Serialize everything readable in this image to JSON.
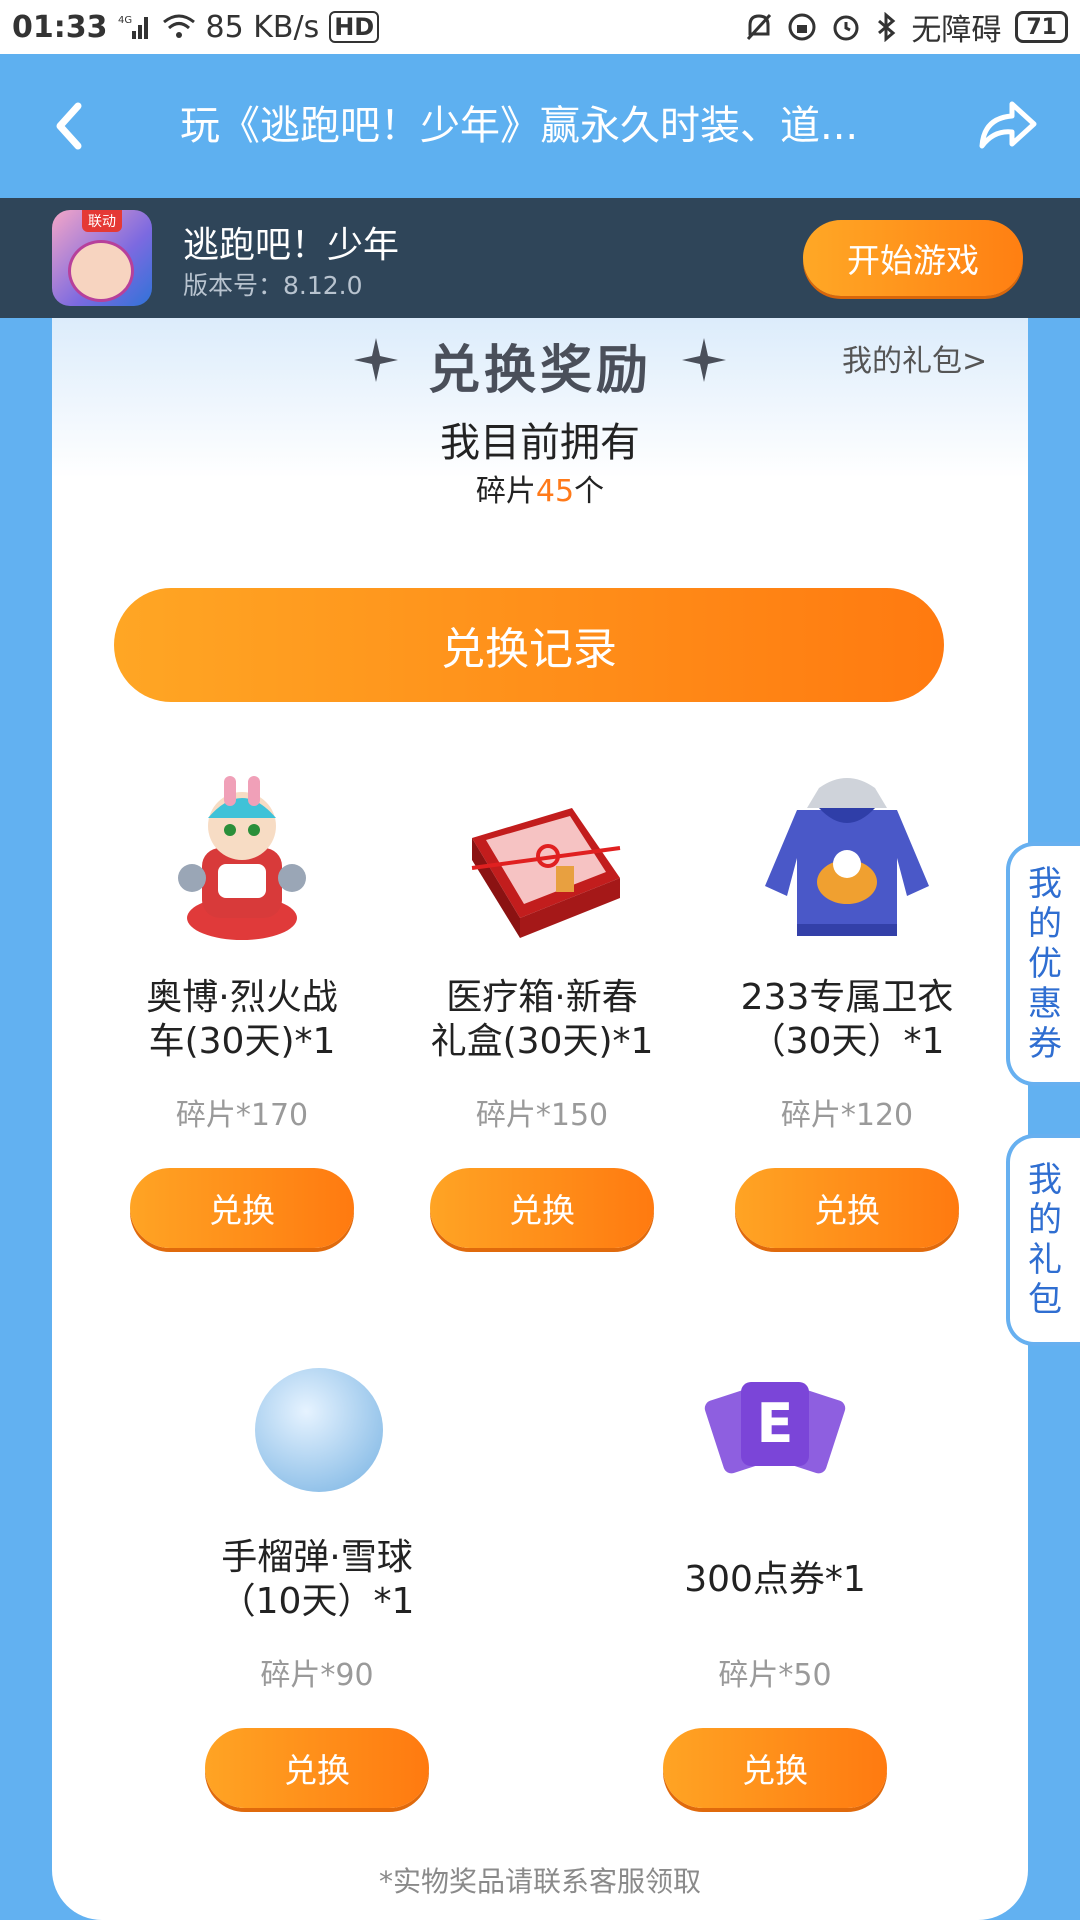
{
  "status_bar": {
    "time": "01:33",
    "network_type": "4G",
    "speed": "85 KB/s",
    "hd": "HD",
    "accessibility": "无障碍",
    "battery": "71"
  },
  "header": {
    "title": "玩《逃跑吧！少年》赢永久时装、道..."
  },
  "game": {
    "tag": "联动",
    "name": "逃跑吧！少年",
    "version": "版本号：8.12.0",
    "play_label": "开始游戏"
  },
  "rewards": {
    "section_title": "兑换奖励",
    "my_gifts_link": "我的礼包>",
    "own_title": "我目前拥有",
    "own_prefix": "碎片",
    "own_count": "45",
    "own_suffix": "个",
    "record_button": "兑换记录",
    "items": [
      {
        "name": "奥博·烈火战车(30天)*1",
        "name_line1": "奥博·烈火战",
        "name_line2": "车(30天)*1",
        "cost": "碎片*170",
        "button": "兑换"
      },
      {
        "name": "医疗箱·新春礼盒(30天)*1",
        "name_line1": "医疗箱·新春",
        "name_line2": "礼盒(30天)*1",
        "cost": "碎片*150",
        "button": "兑换"
      },
      {
        "name": "233专属卫衣（30天）*1",
        "name_line1": "233专属卫衣",
        "name_line2": "（30天）*1",
        "cost": "碎片*120",
        "button": "兑换"
      },
      {
        "name": "手榴弹·雪球（10天）*1",
        "name_line1": "手榴弹·雪球",
        "name_line2": "（10天）*1",
        "cost": "碎片*90",
        "button": "兑换"
      },
      {
        "name": "300点券*1",
        "name_line1": "300点券*1",
        "name_line2": "",
        "cost": "碎片*50",
        "button": "兑换"
      }
    ],
    "footnote": "*实物奖品请联系客服领取"
  },
  "side_tabs": {
    "coupons": [
      "我",
      "的",
      "优",
      "惠",
      "券"
    ],
    "gifts": [
      "我",
      "的",
      "礼",
      "包"
    ]
  },
  "colors": {
    "primary_blue": "#5eb0f0",
    "accent_orange": "#ff7a10",
    "count_orange": "#ff7a1a"
  }
}
